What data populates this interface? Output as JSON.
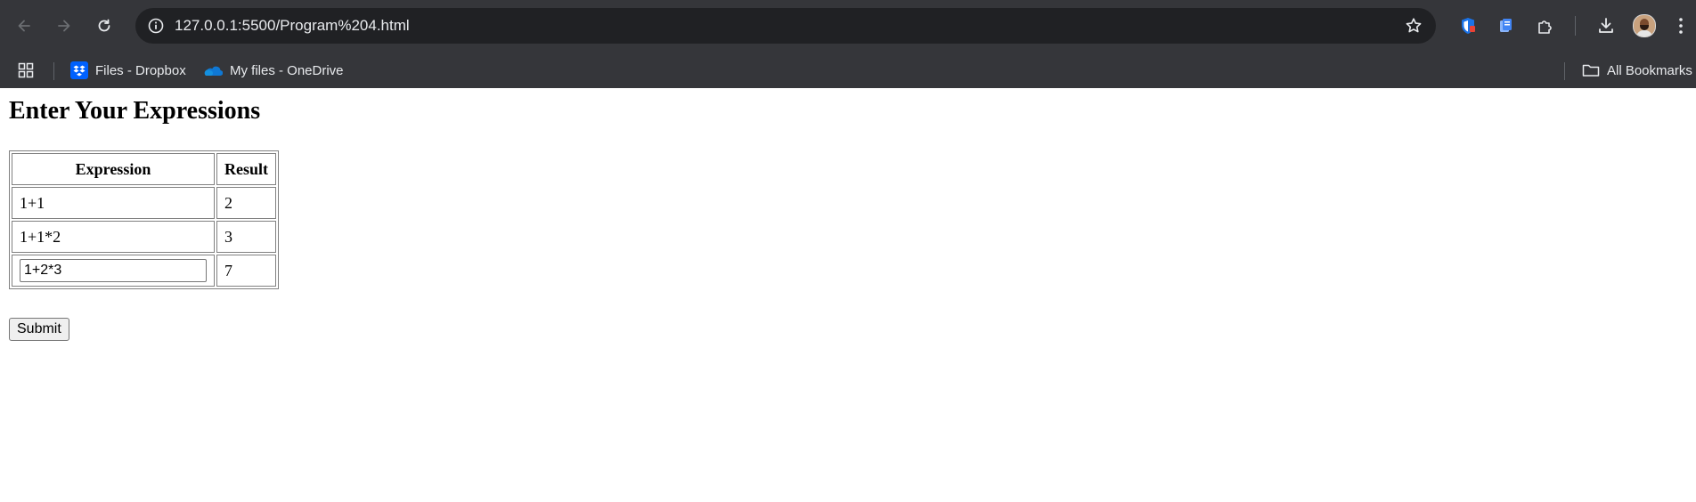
{
  "browser": {
    "url": "127.0.0.1:5500/Program%204.html",
    "bookmarks": [
      {
        "label": "Files - Dropbox",
        "icon": "dropbox-icon"
      },
      {
        "label": "My files - OneDrive",
        "icon": "onedrive-icon"
      }
    ],
    "all_bookmarks_label": "All Bookmarks"
  },
  "page": {
    "title": "Enter Your Expressions",
    "table": {
      "headers": [
        "Expression",
        "Result"
      ],
      "rows": [
        {
          "expression": "1+1",
          "result": "2"
        },
        {
          "expression": "1+1*2",
          "result": "3"
        },
        {
          "expression": "1+2*3",
          "result": "7"
        }
      ]
    },
    "submit_label": "Submit"
  },
  "colors": {
    "chrome_bg": "#35363a",
    "omnibox_bg": "#202124",
    "chrome_text": "#e8eaed",
    "dropbox_blue": "#0061fe",
    "onedrive_blue": "#0f78d4"
  }
}
